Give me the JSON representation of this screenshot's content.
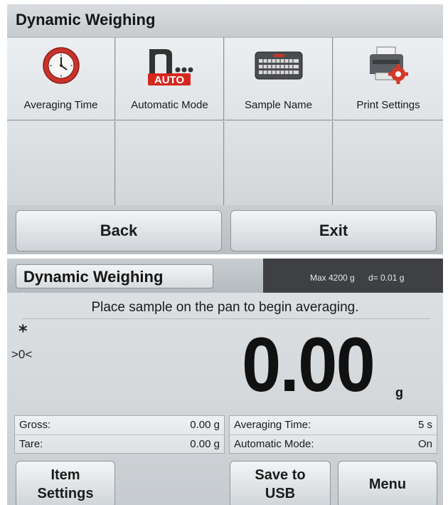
{
  "setup_panel": {
    "title": "Dynamic Weighing",
    "tiles": [
      {
        "label": "Averaging Time",
        "icon": "clock-icon"
      },
      {
        "label": "Automatic Mode",
        "icon": "auto-mode-icon",
        "icon_text": "AUTO"
      },
      {
        "label": "Sample Name",
        "icon": "keyboard-icon"
      },
      {
        "label": "Print Settings",
        "icon": "printer-settings-icon"
      }
    ],
    "back_label": "Back",
    "exit_label": "Exit"
  },
  "weighing_panel": {
    "title": "Dynamic Weighing",
    "capacity": "Max 4200 g",
    "division": "d= 0.01 g",
    "instruction": "Place sample on the pan to begin averaging.",
    "stable_indicator": "*",
    "center_zero_indicator": ">0<",
    "reading": "0.00",
    "unit": "g",
    "info_left": [
      {
        "label": "Gross:",
        "value": "0.00 g"
      },
      {
        "label": "Tare:",
        "value": "0.00 g"
      }
    ],
    "info_right": [
      {
        "label": "Averaging Time:",
        "value": "5 s"
      },
      {
        "label": "Automatic Mode:",
        "value": "On"
      }
    ],
    "buttons": {
      "item_settings": "Item\nSettings",
      "save_to_usb": "Save to\nUSB",
      "menu": "Menu"
    }
  },
  "colors": {
    "clock_red": "#c8332b",
    "auto_red": "#d7261e",
    "capacity_bar": "#3e4043",
    "gear_red": "#d23a2a"
  }
}
